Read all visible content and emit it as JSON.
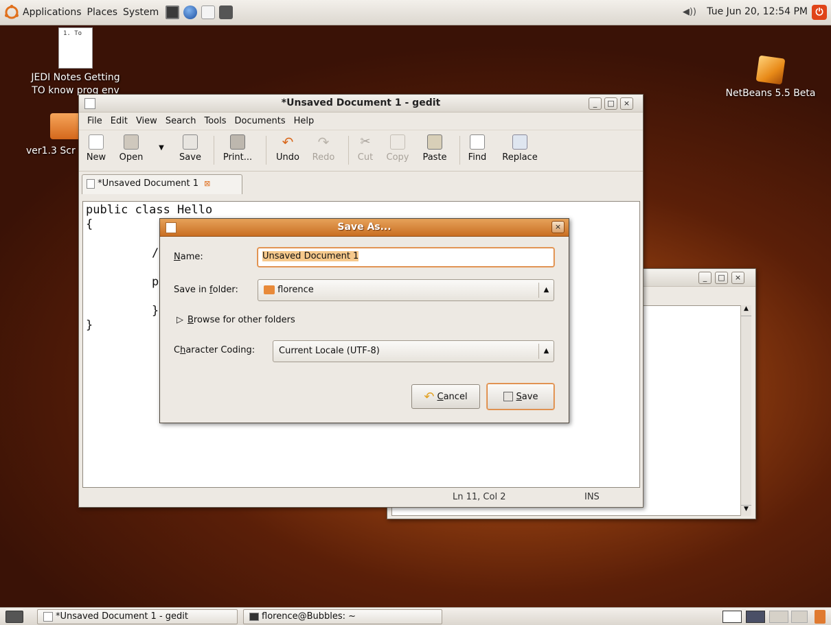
{
  "top_panel": {
    "menus": [
      "Applications",
      "Places",
      "System"
    ],
    "clock": "Tue Jun 20, 12:54 PM",
    "launcher_icons": [
      "terminal-icon",
      "web-browser-icon",
      "mail-icon",
      "screenshot-icon"
    ]
  },
  "desktop": {
    "icons": [
      {
        "name": "JEDI Notes Getting TO know prog env",
        "line1": "JEDI Notes Getting",
        "line2": "TO know prog env",
        "thumb_text": "1. To"
      },
      {
        "name": "ver1.3 Scr",
        "line1": "ver1.3 Scr"
      },
      {
        "name": "NetBeans 5.5 Beta",
        "line1": "NetBeans 5.5 Beta"
      }
    ]
  },
  "gedit": {
    "title": "*Unsaved Document 1 - gedit",
    "menu": {
      "file": "File",
      "edit": "Edit",
      "view": "View",
      "search": "Search",
      "tools": "Tools",
      "documents": "Documents",
      "help": "Help"
    },
    "toolbar": {
      "new": "New",
      "open": "Open",
      "save": "Save",
      "print": "Print...",
      "undo": "Undo",
      "redo": "Redo",
      "cut": "Cut",
      "copy": "Copy",
      "paste": "Paste",
      "find": "Find",
      "replace": "Replace"
    },
    "tab_label": "*Unsaved Document 1",
    "code_lines": [
      "public class Hello",
      "{",
      "/",
      "p",
      "}",
      "}"
    ],
    "status": {
      "position": "Ln 11, Col 2",
      "mode": "INS"
    }
  },
  "save_dialog": {
    "title": "Save As...",
    "name_label_pre": "",
    "name_label_u": "N",
    "name_label_post": "ame:",
    "name_value": "Unsaved Document 1",
    "folder_label_pre": "Save in ",
    "folder_label_u": "f",
    "folder_label_post": "older:",
    "folder_value": "florence",
    "browse_pre": "",
    "browse_u": "B",
    "browse_post": "rowse for other folders",
    "coding_label_pre": "C",
    "coding_label_u": "h",
    "coding_label_post": "aracter Coding:",
    "coding_value": "Current Locale (UTF-8)",
    "cancel_u": "C",
    "cancel_post": "ancel",
    "save_u": "S",
    "save_post": "ave"
  },
  "taskbar": {
    "items": [
      "*Unsaved Document 1 - gedit",
      "florence@Bubbles: ~"
    ]
  },
  "colors": {
    "accent": "#d9803a",
    "selection": "#f6c98c",
    "ubuntu_orange": "#e04418"
  }
}
